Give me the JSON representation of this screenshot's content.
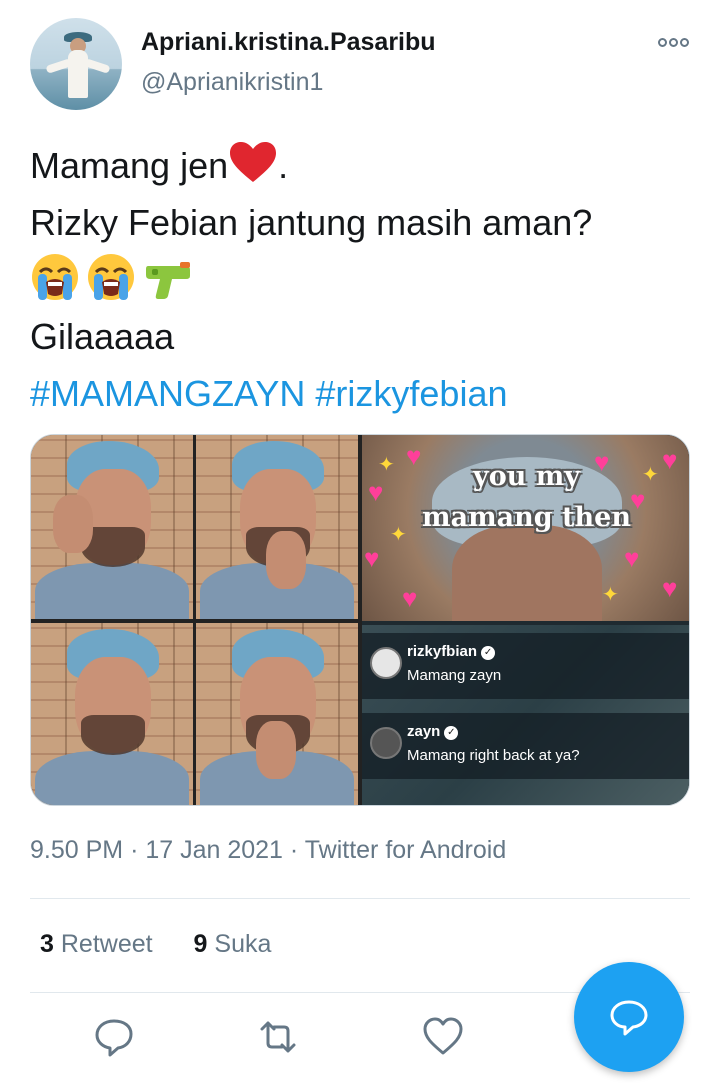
{
  "user": {
    "display_name": "Apriani.kristina.Pasaribu",
    "handle": "@Aprianikristin1"
  },
  "tweet": {
    "line1": "Mamang jen",
    "line1_suffix": ".",
    "line2": "Rizky Febian jantung masih aman?",
    "line4": "Gilaaaaa",
    "hashtag1": "#MAMANGZAYN",
    "hashtag2": "#rizkyfebian",
    "emojis": [
      "red-heart-icon",
      "loudly-crying-face-icon",
      "loudly-crying-face-icon",
      "water-pistol-icon"
    ]
  },
  "media": {
    "meme_caption_line1": "you my",
    "meme_caption_line2": "mamang then",
    "comments": [
      {
        "username": "rizkyfbian",
        "text": "Mamang zayn"
      },
      {
        "username": "zayn",
        "text": "Mamang right back at ya?"
      }
    ]
  },
  "meta": {
    "time": "9.50 PM",
    "date": "17 Jan 2021",
    "source": "Twitter for Android",
    "separator": "·"
  },
  "stats": {
    "retweets_count": "3",
    "retweets_label": "Retweet",
    "likes_count": "9",
    "likes_label": "Suka"
  },
  "colors": {
    "accent": "#1da1f2",
    "hashtag": "#1b95e0",
    "secondary_text": "#657786",
    "primary_text": "#14171a"
  }
}
